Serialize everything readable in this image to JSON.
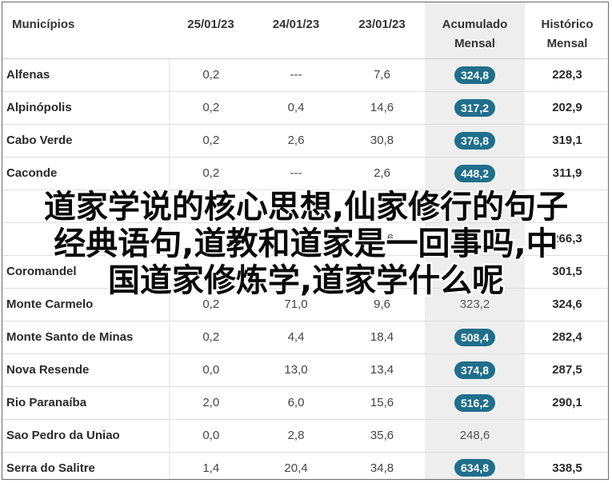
{
  "table": {
    "headers": {
      "municipios": "Municípios",
      "d1": "25/01/23",
      "d2": "24/01/23",
      "d3": "23/01/23",
      "acum_line1": "Acumulado",
      "acum_line2": "Mensal",
      "hist_line1": "Histórico",
      "hist_line2": "Mensal"
    },
    "badge_color": "#1f6f8b",
    "rows": [
      {
        "name": "Alfenas",
        "d1": "0,2",
        "d2": "---",
        "d3": "7,6",
        "acum": "324,8",
        "hist": "228,3",
        "badge": true
      },
      {
        "name": "Alpinópolis",
        "d1": "0,2",
        "d2": "0,4",
        "d3": "14,6",
        "acum": "317,2",
        "hist": "202,9",
        "badge": true
      },
      {
        "name": "Cabo Verde",
        "d1": "0,2",
        "d2": "2,6",
        "d3": "30,8",
        "acum": "376,8",
        "hist": "319,1",
        "badge": true
      },
      {
        "name": "Caconde",
        "d1": "0,2",
        "d2": "---",
        "d3": "2,6",
        "acum": "448,2",
        "hist": "311,9",
        "badge": true
      },
      {
        "name": "",
        "d1": "",
        "d2": "",
        "d3": "",
        "acum": "",
        "hist": "",
        "badge": false
      },
      {
        "name": "",
        "d1": "",
        "d2": "",
        "d3": "12,6",
        "acum": "",
        "hist": "266,3",
        "badge": false
      },
      {
        "name": "Coromandel",
        "d1": "",
        "d2": "",
        "d3": "",
        "acum": "",
        "hist": "301,5",
        "badge": false
      },
      {
        "name": "Monte Carmelo",
        "d1": "0,2",
        "d2": "71,0",
        "d3": "9,6",
        "acum": "323,2",
        "hist": "324,6",
        "badge": false
      },
      {
        "name": "Monte Santo de Minas",
        "d1": "0,2",
        "d2": "4,4",
        "d3": "18,4",
        "acum": "508,4",
        "hist": "282,4",
        "badge": true
      },
      {
        "name": "Nova Resende",
        "d1": "0,0",
        "d2": "13,0",
        "d3": "13,4",
        "acum": "374,8",
        "hist": "287,5",
        "badge": true
      },
      {
        "name": "Rio Paranaíba",
        "d1": "2,0",
        "d2": "6,0",
        "d3": "15,6",
        "acum": "516,2",
        "hist": "290,1",
        "badge": true
      },
      {
        "name": "Sao Pedro da Uniao",
        "d1": "0,0",
        "d2": "2,8",
        "d3": "35,6",
        "acum": "248,6",
        "hist": "",
        "badge": false
      },
      {
        "name": "Serra do Salitre",
        "d1": "1,4",
        "d2": "20,4",
        "d3": "34,8",
        "acum": "634,8",
        "hist": "338,5",
        "badge": true
      }
    ]
  },
  "overlay": {
    "line1": "道家学说的核心思想,仙家修行的句子",
    "line2": "经典语句,道教和道家是一回事吗,中",
    "line3": "国道家修炼学,道家学什么呢"
  }
}
